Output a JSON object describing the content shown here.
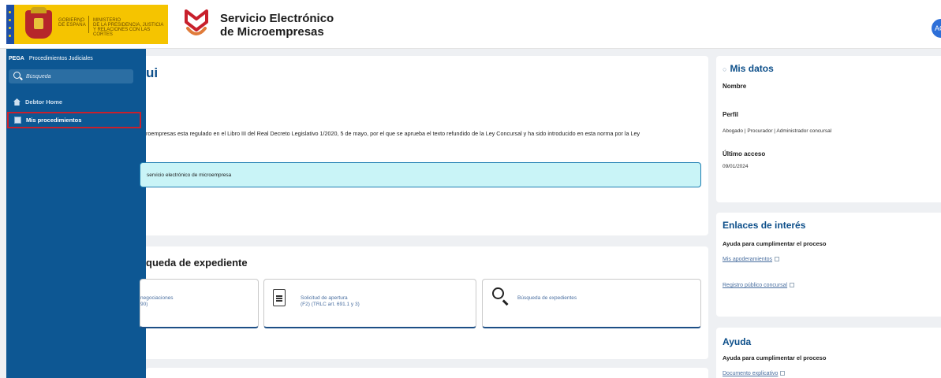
{
  "header": {
    "gov_lines": [
      "GOBIERNO",
      "DE ESPAÑA"
    ],
    "ministry_lines": [
      "MINISTERIO",
      "DE LA PRESIDENCIA, JUSTICIA",
      "Y RELACIONES CON LAS CORTES"
    ],
    "site_title_line1": "Servicio Electrónico",
    "site_title_line2": "de Microempresas",
    "avatar_initials": "AC",
    "colors": {
      "gov_yellow": "#f5c400",
      "sidebar_blue": "#0d5793",
      "accent_red": "#c8202c"
    }
  },
  "sidebar": {
    "brand": "PEGA",
    "app_name": "Procedimientos Judiciales",
    "search_placeholder": "Búsqueda",
    "items": [
      {
        "label": "Debtor Home",
        "icon": "home-icon"
      },
      {
        "label": "Mis procedimientos",
        "icon": "list-icon",
        "highlighted": true
      }
    ]
  },
  "main": {
    "welcome_title": "ui",
    "welcome_text": "roempresas esta regulado en el Libro III del Real Decreto Legislativo 1/2020, 5 de mayo, por el que se aprueba el texto refundido de la Ley Concursal y ha sido introducido en esta norma por la Ley",
    "info_text": "servicio electrónico de microempresa",
    "search_title": "queda de expediente",
    "tiles": [
      {
        "line1": "negociaciones",
        "line2": "90)"
      },
      {
        "line1": "Solicitud de apertura",
        "line2": "(F2) (TRLC art. 691.1 y 3)",
        "icon": "document-icon"
      },
      {
        "line1": "Búsqueda de expedientes",
        "line2": "",
        "icon": "magnifier-icon"
      }
    ]
  },
  "right_panel": {
    "mis_datos": {
      "title": "Mis datos",
      "nombre_label": "Nombre",
      "perfil_label": "Perfil",
      "perfil_value": "Abogado | Procurador | Administrador concursal",
      "ultimo_acceso_label": "Último acceso",
      "ultimo_acceso_value": "09/01/2024"
    },
    "enlaces": {
      "title": "Enlaces de interés",
      "subtitle": "Ayuda para cumplimentar el proceso",
      "links": [
        "Mis apoderamientos",
        "Registro público concursal"
      ]
    },
    "ayuda": {
      "title": "Ayuda",
      "subtitle": "Ayuda para cumplimentar el proceso",
      "link": "Documento explicativo"
    }
  }
}
